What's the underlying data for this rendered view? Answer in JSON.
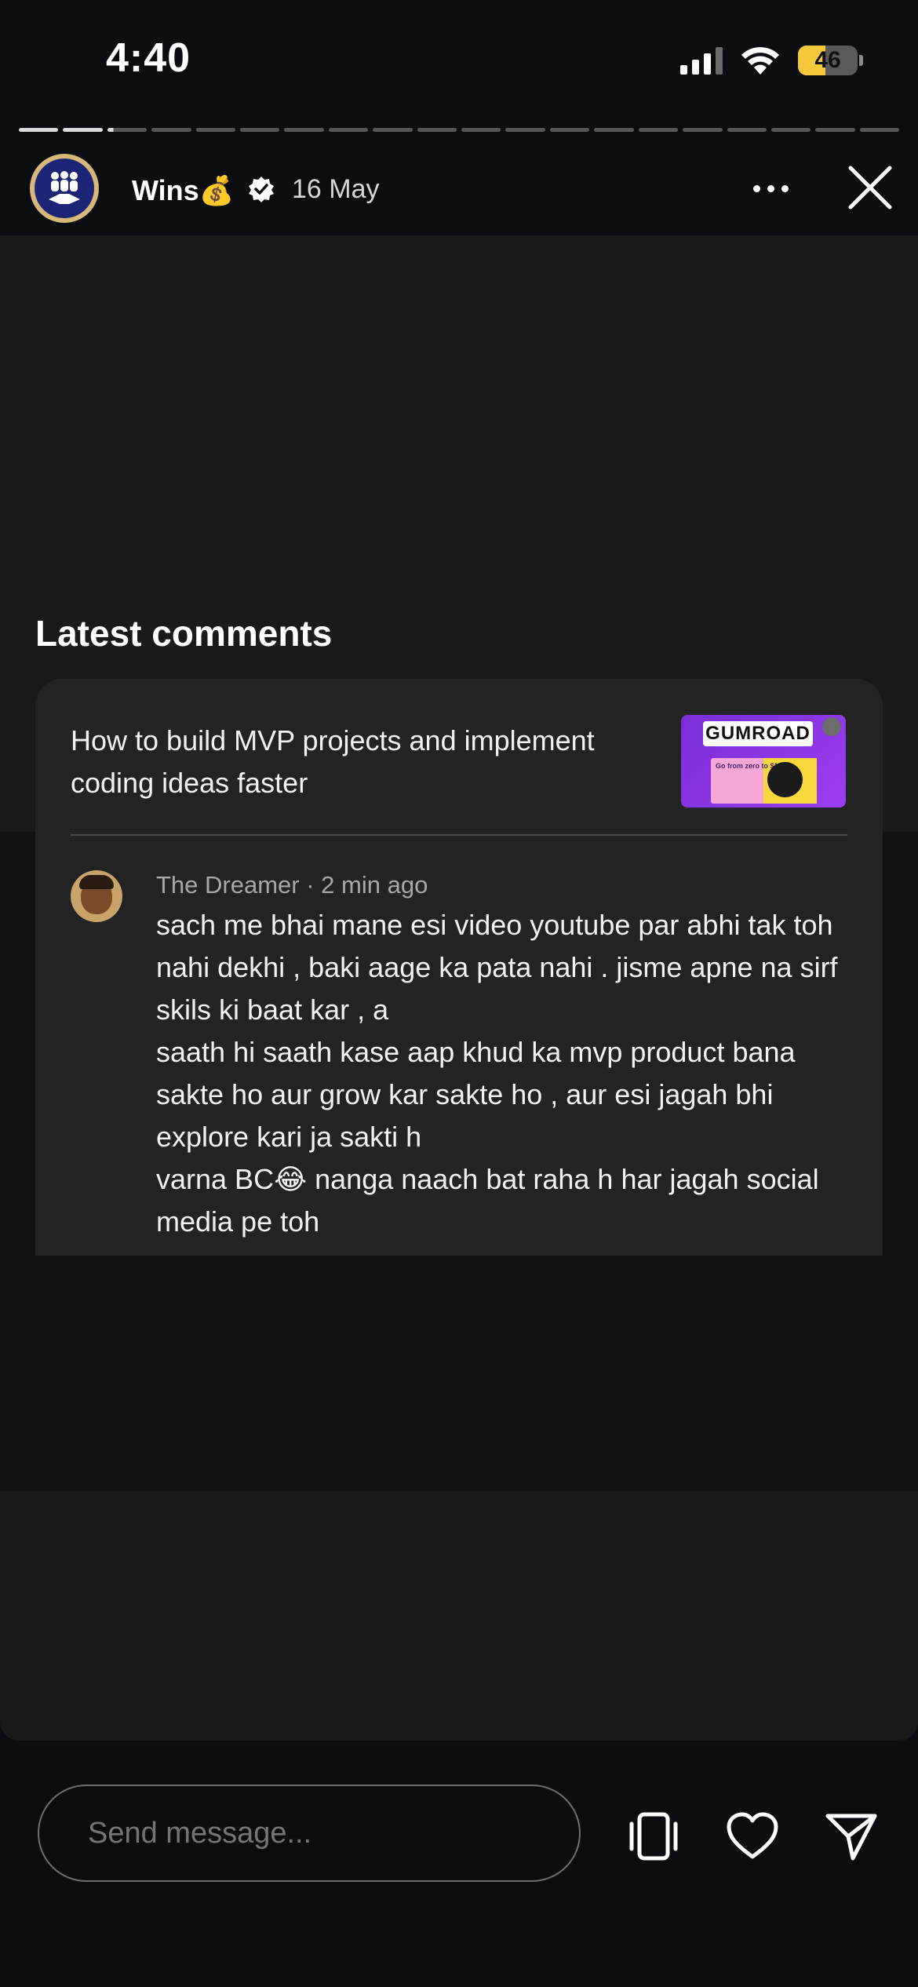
{
  "status_bar": {
    "time": "4:40",
    "battery_percent": "46"
  },
  "story": {
    "progress_total": 20,
    "progress_viewed": 2,
    "progress_current_fraction": 0.15,
    "account_name": "Wins💰",
    "date": "16 May"
  },
  "latest_comments": {
    "title": "Latest comments",
    "video_title": "How to build MVP projects and implement coding ideas faster",
    "thumbnail_text": "GUMROAD",
    "thumbnail_caption": "Go from zero to $1",
    "comment": {
      "author": "The Dreamer",
      "time": "2 min ago",
      "text": "sach me bhai mane esi video youtube par abhi tak toh nahi dekhi , baki aage ka pata nahi . jisme apne na sirf skils ki baat kar , a\nsaath hi saath kase aap khud ka mvp product bana sakte ho aur grow kar sakte ho , aur esi jagah bhi explore kari ja sakti h\nvarna BC😂 nanga naach bat raha h har jagah social media pe toh"
    }
  },
  "bottom_bar": {
    "message_placeholder": "Send message...",
    "icons": [
      "device-rotate-icon",
      "heart-icon",
      "send-icon"
    ]
  },
  "colors": {
    "background": "#0b0d10",
    "story_background": "#1a1a1a",
    "card_background": "#232324",
    "battery_fill": "#f5c73a"
  }
}
